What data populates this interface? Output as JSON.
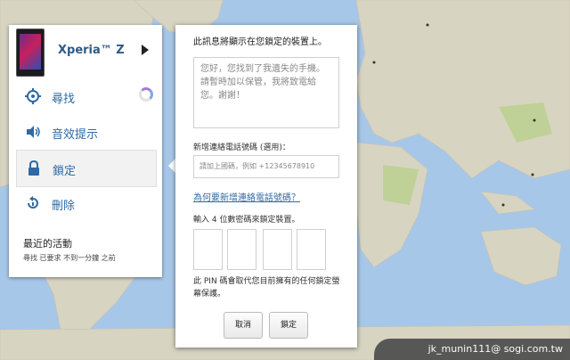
{
  "device": {
    "name": "Xperia™ Z"
  },
  "menu": {
    "items": [
      {
        "label": "尋找",
        "icon": "locate-icon"
      },
      {
        "label": "音效提示",
        "icon": "speaker-icon"
      },
      {
        "label": "鎖定",
        "icon": "lock-icon",
        "active": true
      },
      {
        "label": "刪除",
        "icon": "erase-icon"
      }
    ]
  },
  "recent": {
    "title": "最近的活動",
    "status": "尋找 已要求 不到一分鐘 之前"
  },
  "dialog": {
    "title": "此訊息將顯示在您鎖定的裝置上。",
    "message": "您好，您找到了我遺失的手機。請暫時加以保管，我將致電給您。謝謝！",
    "phone_label": "新增連絡電話號碼 (選用)：",
    "phone_placeholder": "請加上國碼，例如 +12345678910",
    "why_link": "為何要新增連絡電話號碼？",
    "pin_label": "輸入 4 位數密碼來鎖定裝置。",
    "note": "此 PIN 碼會取代您目前擁有的任何鎖定螢幕保護。",
    "cancel": "取消",
    "lock": "鎖定"
  },
  "watermark": "jk_munin111@ sogi.com.tw",
  "colors": {
    "accent": "#2f6aa3",
    "ocean": "#a7c7e8",
    "land": "#d9d3c1"
  }
}
